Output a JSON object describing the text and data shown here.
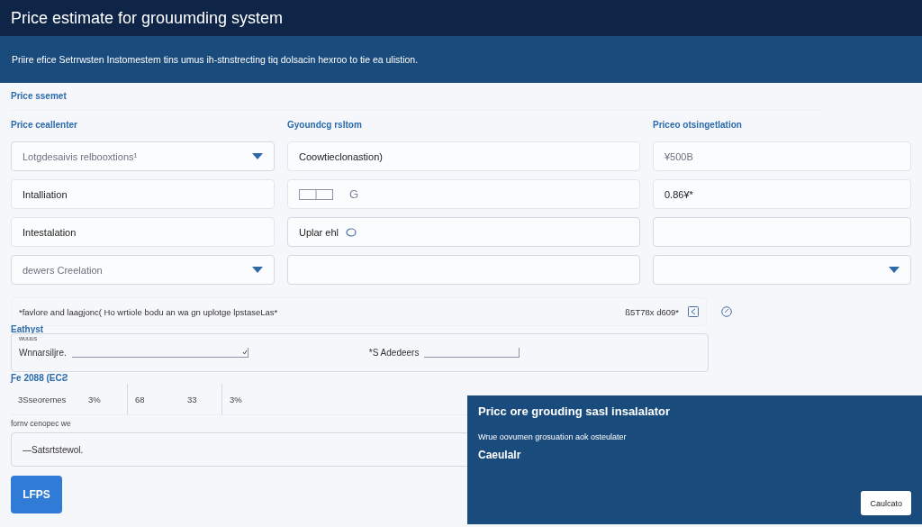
{
  "header": {
    "title": "Price estimate for grouumding system"
  },
  "banner": {
    "text": "Priire efice Setrrwsten Instomestem tins umus ih-stnstrecting tiq dolsacin hexroo to tie ea ulistion."
  },
  "section_label": "Price ssemet",
  "columns": [
    {
      "label": "Price ceallenter",
      "fields": [
        {
          "kind": "select",
          "placeholder": "Lotgdesaivis relbooxtions¹"
        },
        {
          "kind": "text",
          "value": "Intalliation"
        },
        {
          "kind": "text",
          "value": "Intestalation"
        },
        {
          "kind": "select",
          "placeholder": "dewers Creelation"
        }
      ]
    },
    {
      "label": "Gyoundcg rsltom",
      "fields": [
        {
          "kind": "text",
          "value": "Coowtieclonastion)"
        },
        {
          "kind": "toggle",
          "value": "G"
        },
        {
          "kind": "status",
          "value": "Uplar ehl"
        },
        {
          "kind": "text"
        }
      ]
    },
    {
      "label": "Priceo otsingetlation",
      "fields": [
        {
          "kind": "text",
          "placeholder": "¥500B"
        },
        {
          "kind": "text",
          "value": "0.86¥*"
        },
        {
          "kind": "text"
        },
        {
          "kind": "select"
        }
      ]
    }
  ],
  "note": {
    "text": "*favlore and laagjonc( Ho wrtiole bodu an wa gn uplotge lpstaseLas*",
    "amount": "ß5T78x d609*"
  },
  "group": {
    "label": "Eathyst",
    "caption": "wuuus",
    "fields": [
      {
        "label": "Wnnarsiljre.",
        "kind": "select"
      },
      {
        "label": "*S Adedeers",
        "kind": "text"
      }
    ]
  },
  "table": {
    "label": "Ƒe 2088 (ECƧ",
    "groups": [
      {
        "cells": [
          "3Sseoremes",
          "3%"
        ]
      },
      {
        "cells": [
          "68",
          "33"
        ]
      },
      {
        "cells": [
          "3%"
        ]
      }
    ]
  },
  "footer_field": {
    "label": "fornv cenopec we",
    "value": "—Satsrtstewol."
  },
  "primary_button": "LFPS",
  "dialog": {
    "title": "Pricc ore grouding sasl insalalator",
    "text": "Wrue oovumen grosuation aok osteulater",
    "result": "Caeulalr",
    "button": "Caulcato"
  }
}
